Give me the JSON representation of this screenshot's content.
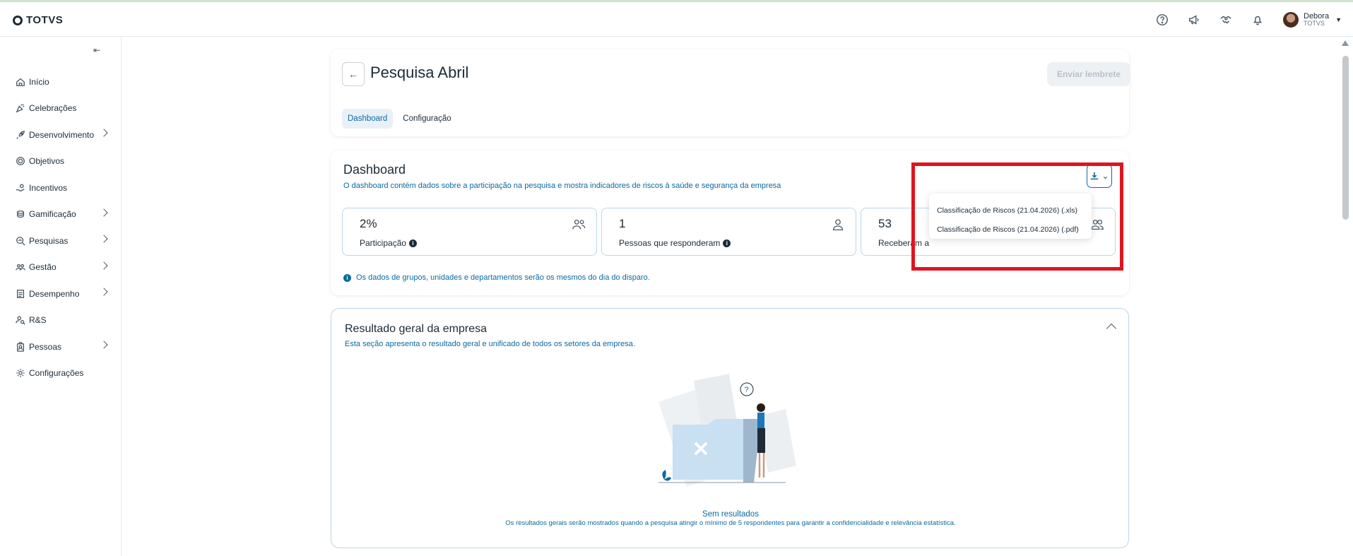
{
  "header": {
    "logo_text": "TOTVS",
    "user_name": "Debora",
    "user_org": "TOTVS",
    "icons": [
      "help-icon",
      "megaphone-icon",
      "handshake-icon",
      "bell-icon"
    ]
  },
  "sidebar": {
    "collapse_icon": "collapse-icon",
    "items": [
      {
        "label": "Início",
        "icon": "home-icon",
        "has_children": false
      },
      {
        "label": "Celebrações",
        "icon": "party-icon",
        "has_children": false
      },
      {
        "label": "Desenvolvimento",
        "icon": "rocket-icon",
        "has_children": true
      },
      {
        "label": "Objetivos",
        "icon": "target-icon",
        "has_children": false
      },
      {
        "label": "Incentivos",
        "icon": "hand-coin-icon",
        "has_children": false
      },
      {
        "label": "Gamificação",
        "icon": "coins-icon",
        "has_children": true
      },
      {
        "label": "Pesquisas",
        "icon": "search-chart-icon",
        "has_children": true
      },
      {
        "label": "Gestão",
        "icon": "team-icon",
        "has_children": true
      },
      {
        "label": "Desempenho",
        "icon": "clipboard-icon",
        "has_children": true
      },
      {
        "label": "R&S",
        "icon": "user-search-icon",
        "has_children": false
      },
      {
        "label": "Pessoas",
        "icon": "badge-icon",
        "has_children": true
      },
      {
        "label": "Configurações",
        "icon": "gear-icon",
        "has_children": false
      }
    ]
  },
  "survey": {
    "title": "Pesquisa Abril",
    "remind_button": "Enviar lembrete",
    "tabs": [
      {
        "label": "Dashboard",
        "active": true
      },
      {
        "label": "Configuração",
        "active": false
      }
    ]
  },
  "dashboard": {
    "title": "Dashboard",
    "subtitle": "O dashboard contém dados sobre a participação na pesquisa e mostra indicadores de riscos à saúde e segurança da empresa",
    "stats": [
      {
        "value": "2%",
        "label": "Participação",
        "icon": "users-icon"
      },
      {
        "value": "1",
        "label": "Pessoas que responderam",
        "icon": "user-icon"
      },
      {
        "value": "53",
        "label": "Receberam a",
        "icon": "users-icon"
      }
    ],
    "note": "Os dados de grupos, unidades e departamentos serão os mesmos do dia do disparo.",
    "download_menu": [
      "Classificação de Riscos (21.04.2026) (.xls)",
      "Classificação de Riscos (21.04.2026) (.pdf)"
    ]
  },
  "result": {
    "title": "Resultado geral da empresa",
    "subtitle": "Esta seção apresenta o resultado geral e unificado de todos os setores da empresa.",
    "empty_title": "Sem resultados",
    "empty_sub": "Os resultados gerais serão mostrados quando a pesquisa atingir o mínimo de 5 respondentes para garantir a confidencialidade e relevância estatística."
  },
  "colors": {
    "accent": "#0c6a9e",
    "highlight": "#e0141e"
  }
}
